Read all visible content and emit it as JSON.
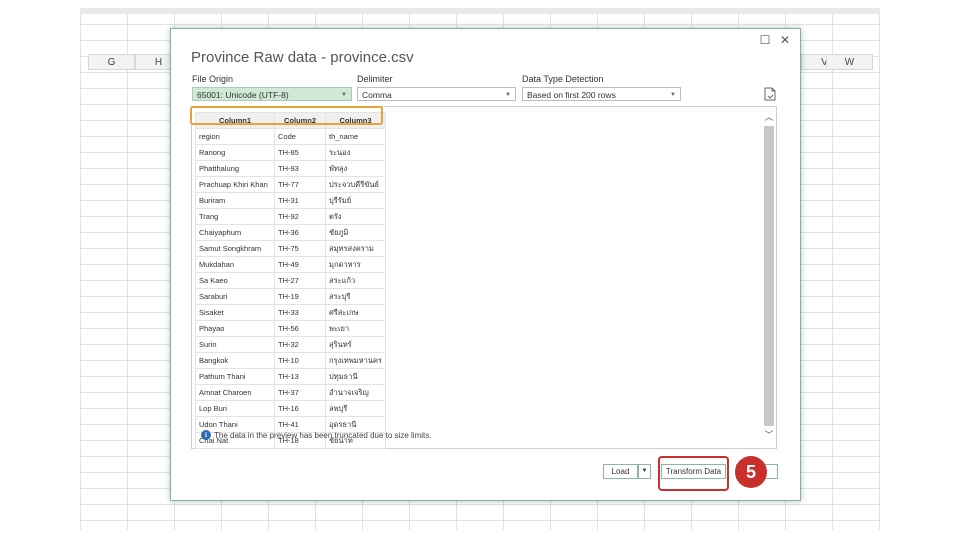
{
  "sheet": {
    "columns_left": [
      "G",
      "H"
    ],
    "columns_right": [
      "V",
      "W"
    ]
  },
  "dialog": {
    "title": "Province Raw data - province.csv",
    "maximize_glyph": "☐",
    "close_glyph": "✕",
    "file_origin": {
      "label": "File Origin",
      "value": "65001: Unicode (UTF-8)"
    },
    "delimiter": {
      "label": "Delimiter",
      "value": "Comma"
    },
    "type_detection": {
      "label": "Data Type Detection",
      "value": "Based on first 200 rows"
    },
    "icons": {
      "export": "document-icon",
      "info": "info-icon"
    },
    "table": {
      "headers": [
        "Column1",
        "Column2",
        "Column3"
      ],
      "rows": [
        [
          "region",
          "Code",
          "th_name"
        ],
        [
          "Ranong",
          "TH-85",
          "ระนอง"
        ],
        [
          "Phatthalung",
          "TH-93",
          "พัทลุง"
        ],
        [
          "Prachuap Khiri Khan",
          "TH-77",
          "ประจวบคีรีขันธ์"
        ],
        [
          "Buriram",
          "TH-31",
          "บุรีรัมย์"
        ],
        [
          "Trang",
          "TH-92",
          "ตรัง"
        ],
        [
          "Chaiyaphum",
          "TH-36",
          "ชัยภูมิ"
        ],
        [
          "Samut Songkhram",
          "TH-75",
          "สมุทรสงคราม"
        ],
        [
          "Mukdahan",
          "TH-49",
          "มุกดาหาร"
        ],
        [
          "Sa Kaeo",
          "TH-27",
          "สระแก้ว"
        ],
        [
          "Saraburi",
          "TH-19",
          "สระบุรี"
        ],
        [
          "Sisaket",
          "TH-33",
          "ศรีสะเกษ"
        ],
        [
          "Phayao",
          "TH-56",
          "พะเยา"
        ],
        [
          "Surin",
          "TH-32",
          "สุรินทร์"
        ],
        [
          "Bangkok",
          "TH-10",
          "กรุงเทพมหานคร"
        ],
        [
          "Pathum Thani",
          "TH-13",
          "ปทุมธานี"
        ],
        [
          "Amnat Charoen",
          "TH-37",
          "อำนาจเจริญ"
        ],
        [
          "Lop Buri",
          "TH-16",
          "ลพบุรี"
        ],
        [
          "Udon Thani",
          "TH-41",
          "อุดรธานี"
        ],
        [
          "Chai Nat",
          "TH-18",
          "ชัยนาท"
        ]
      ]
    },
    "truncation_note": "The data in the preview has been truncated due to size limits.",
    "load_label": "Load",
    "transform_label": "Transform Data"
  },
  "annotation": {
    "step_number": "5",
    "highlight_color": "#e8a23b",
    "step_color": "#c9302c"
  }
}
